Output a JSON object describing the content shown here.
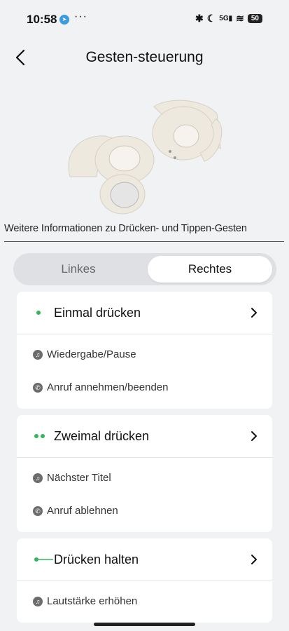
{
  "status_bar": {
    "time": "10:58",
    "battery": "50",
    "network": "5G"
  },
  "header": {
    "title": "Gesten-steuerung"
  },
  "info_link": "Weitere Informationen zu Drücken- und Tippen-Gesten",
  "segment": {
    "left_label": "Linkes",
    "right_label": "Rechtes",
    "selected": "Rechtes"
  },
  "colors": {
    "accent_green": "#34b55a",
    "background": "#f1f2f4"
  },
  "cards": [
    {
      "title": "Einmal drücken",
      "indicator": "single-dot",
      "actions": [
        {
          "icon": "music-note-icon",
          "label": "Wiedergabe/Pause"
        },
        {
          "icon": "phone-icon",
          "label": "Anruf annehmen/beenden"
        }
      ]
    },
    {
      "title": "Zweimal drücken",
      "indicator": "double-dot",
      "actions": [
        {
          "icon": "music-note-icon",
          "label": "Nächster Titel"
        },
        {
          "icon": "phone-icon",
          "label": "Anruf ablehnen"
        }
      ]
    },
    {
      "title": "Drücken halten",
      "indicator": "dot-line",
      "actions": [
        {
          "icon": "music-note-icon",
          "label": "Lautstärke erhöhen"
        }
      ]
    }
  ]
}
